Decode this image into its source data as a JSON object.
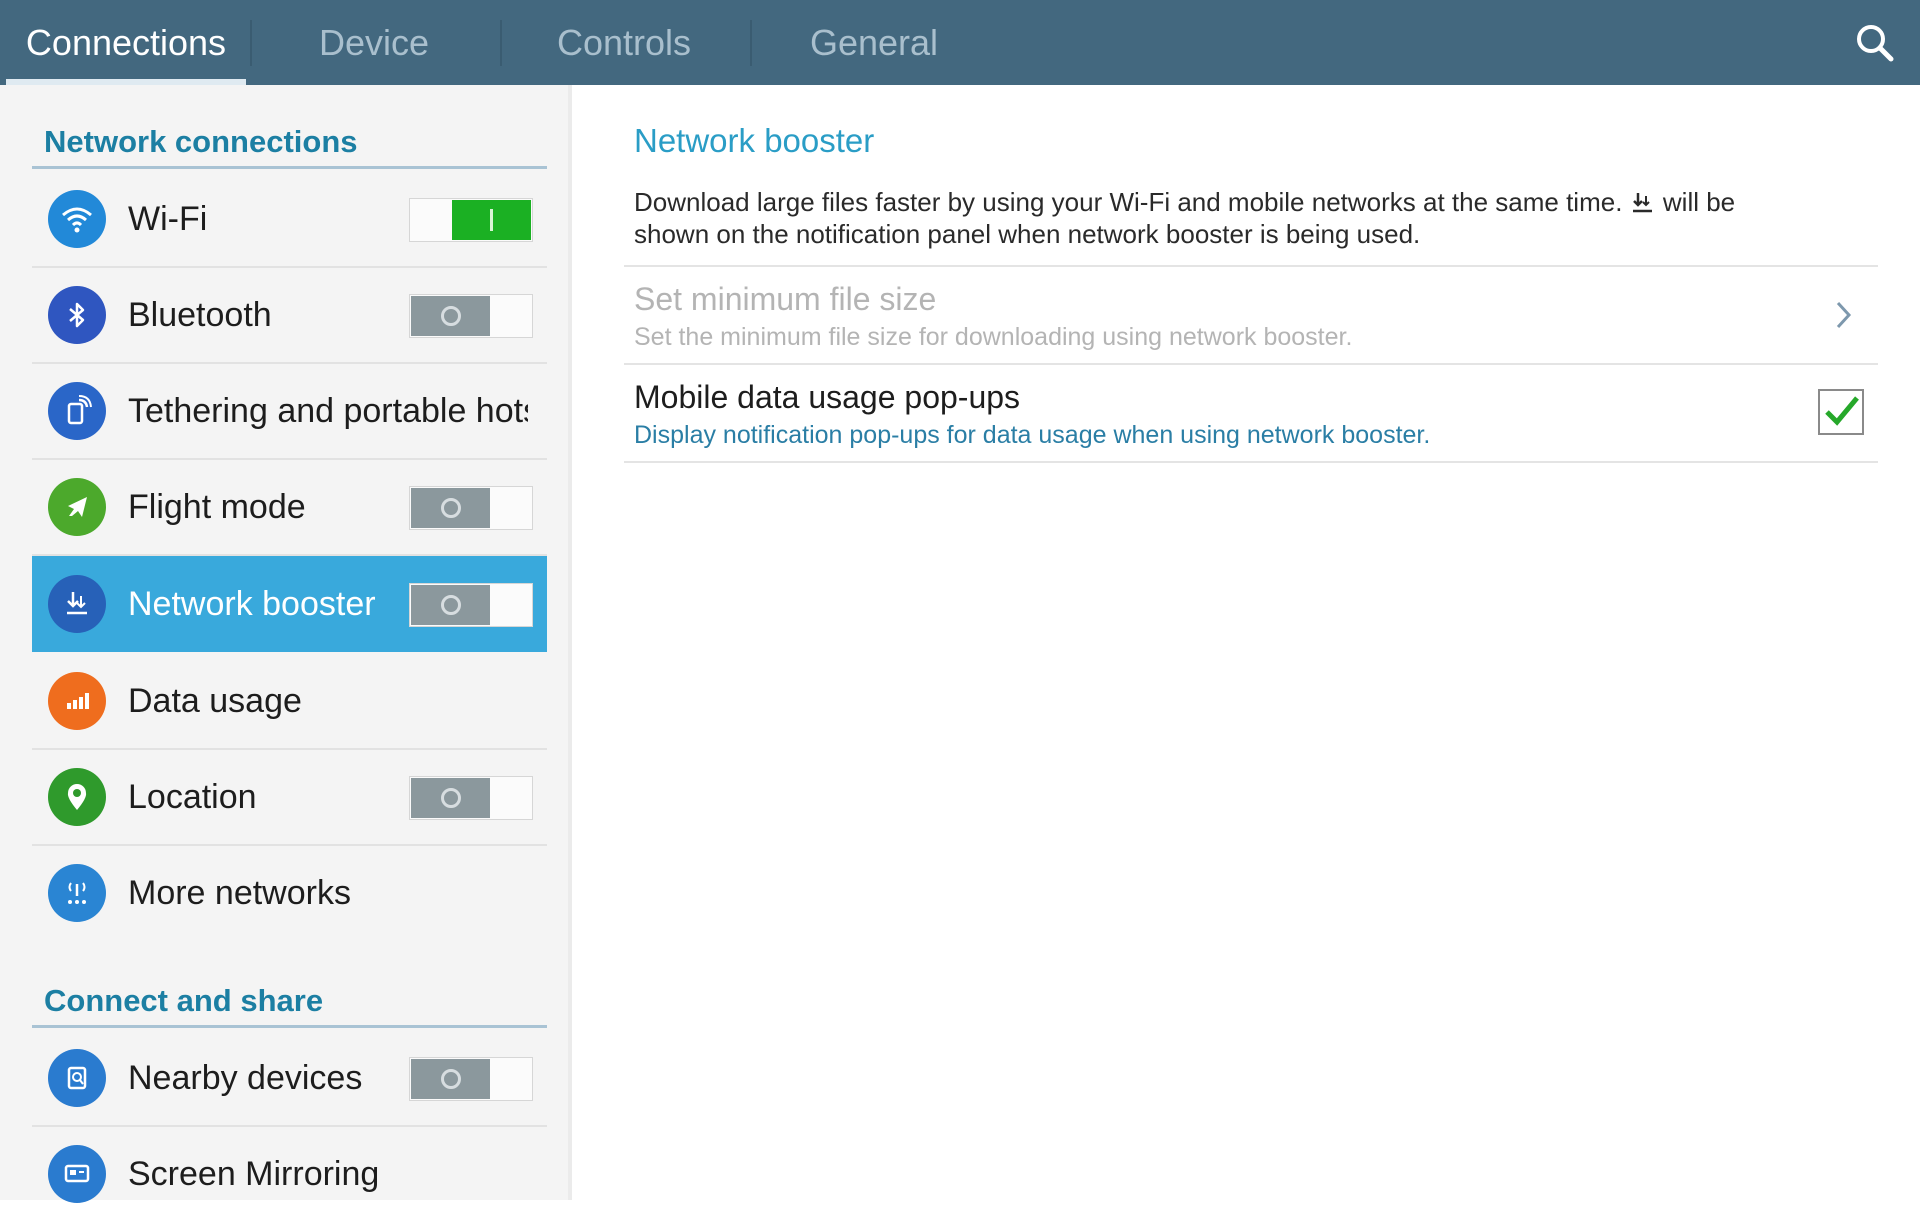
{
  "tabs": [
    {
      "label": "Connections",
      "active": true
    },
    {
      "label": "Device",
      "active": false
    },
    {
      "label": "Controls",
      "active": false
    },
    {
      "label": "General",
      "active": false
    }
  ],
  "search_icon": "search-icon",
  "left": {
    "sections": [
      {
        "title": "Network connections"
      },
      {
        "title": "Connect and share"
      }
    ],
    "items": [
      {
        "label": "Wi-Fi",
        "icon": "wifi-icon",
        "icon_color": "#2289d8",
        "toggle": "on"
      },
      {
        "label": "Bluetooth",
        "icon": "bluetooth-icon",
        "icon_color": "#2f56c0",
        "toggle": "off"
      },
      {
        "label": "Tethering and portable hotspot",
        "icon": "tethering-icon",
        "icon_color": "#2a66c8"
      },
      {
        "label": "Flight mode",
        "icon": "airplane-icon",
        "icon_color": "#4ca92c",
        "toggle": "off"
      },
      {
        "label": "Network booster",
        "icon": "network-booster-icon",
        "icon_color": "#2761b8",
        "toggle": "off",
        "selected": true
      },
      {
        "label": "Data usage",
        "icon": "data-usage-icon",
        "icon_color": "#ef6d1e"
      },
      {
        "label": "Location",
        "icon": "location-icon",
        "icon_color": "#2f9a2c",
        "toggle": "off"
      },
      {
        "label": "More networks",
        "icon": "more-networks-icon",
        "icon_color": "#2a85d3"
      },
      {
        "label": "Nearby devices",
        "icon": "nearby-devices-icon",
        "icon_color": "#2a7bcf",
        "toggle": "off"
      },
      {
        "label": "Screen Mirroring",
        "icon": "screen-mirroring-icon",
        "icon_color": "#2a7bcf"
      }
    ]
  },
  "right": {
    "title": "Network booster",
    "description_1": "Download large files faster by using your Wi-Fi and mobile networks at the same time.",
    "description_2": "will be shown on the notification panel when network booster is being used.",
    "settings": [
      {
        "title": "Set minimum file size",
        "subtitle": "Set the minimum file size for downloading using network booster.",
        "enabled": false
      },
      {
        "title": "Mobile data usage pop-ups",
        "subtitle": "Display notification pop-ups for data usage when using network booster.",
        "checked": true
      }
    ]
  },
  "colors": {
    "topbar": "#43687f",
    "accent": "#39a9dc",
    "toggle_on": "#1bb023",
    "check": "#26a82a"
  }
}
